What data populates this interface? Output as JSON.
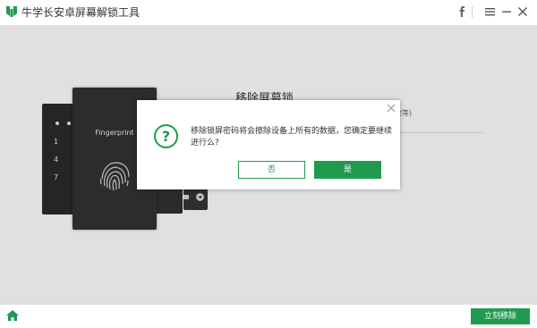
{
  "window": {
    "title": "牛学长安卓屏幕解锁工具"
  },
  "colors": {
    "brand_green": "#1f9a4f",
    "phone_dark": "#333333"
  },
  "titlebar": {
    "icons": [
      "app-logo-icon",
      "facebook-icon",
      "menu-icon",
      "minimize-icon",
      "close-icon"
    ]
  },
  "background": {
    "headline": "移除屏幕锁",
    "subtext_fragment": "纹等)",
    "illustration": {
      "phone_screen_label": "Fingerprint",
      "keypad_numbers": [
        "1",
        "4",
        "7"
      ]
    }
  },
  "dialog": {
    "message": "移除锁屏密码将会擦除设备上所有的数据，您确定要继续进行么?",
    "no_label": "否",
    "yes_label": "是"
  },
  "footer": {
    "action_label": "立刻移除"
  }
}
